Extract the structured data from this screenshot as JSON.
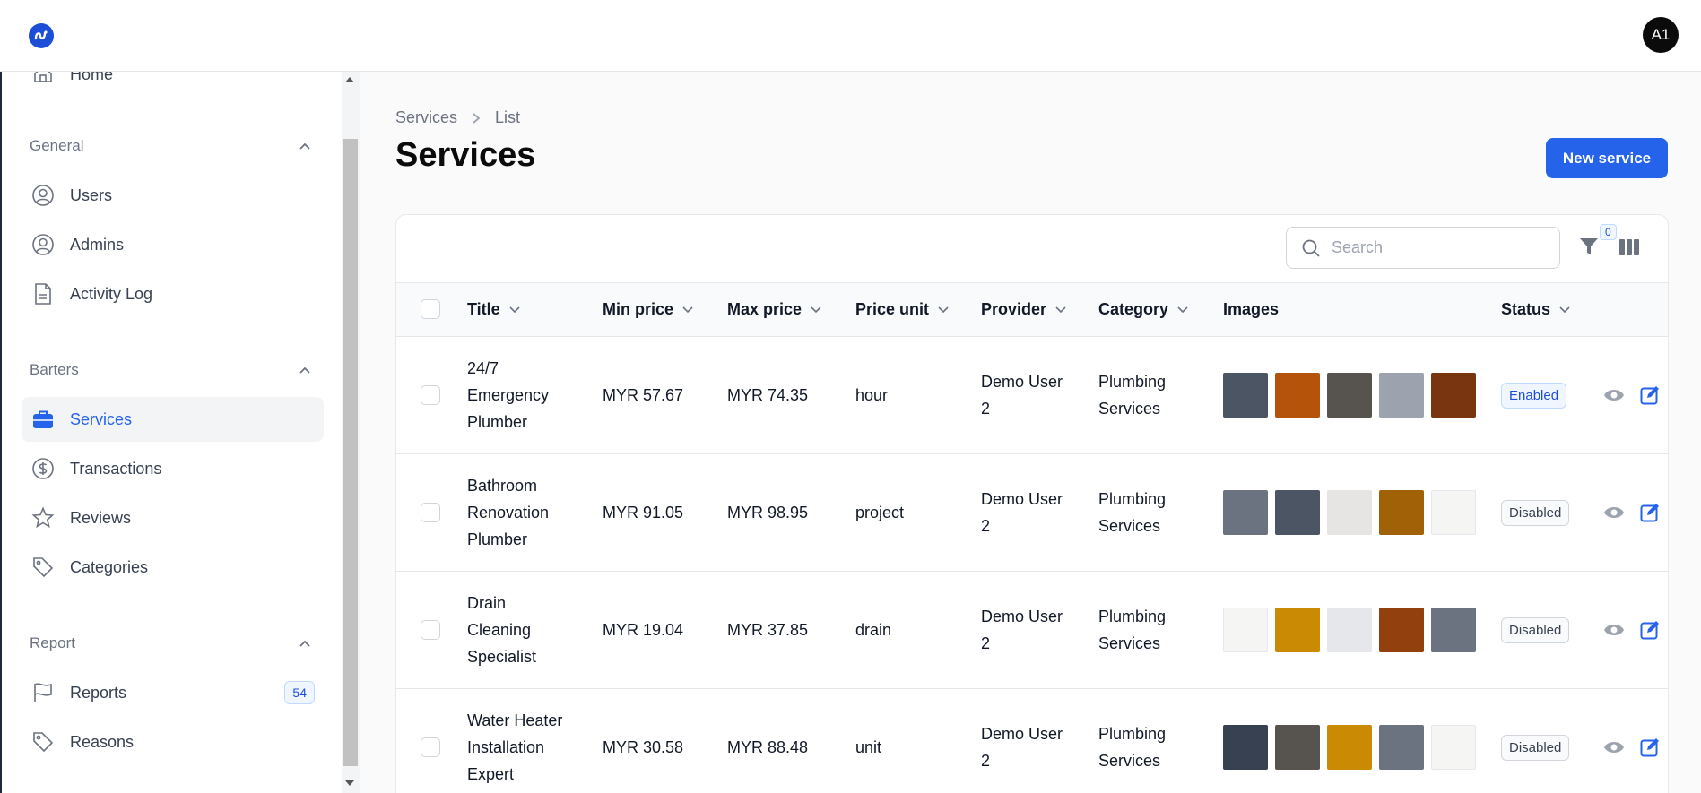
{
  "header": {
    "avatar_initials": "A1"
  },
  "sidebar": {
    "home_label": "Home",
    "groups": [
      {
        "label": "General",
        "items": [
          {
            "label": "Users",
            "icon": "user-circle-icon"
          },
          {
            "label": "Admins",
            "icon": "user-circle-icon"
          },
          {
            "label": "Activity Log",
            "icon": "document-icon"
          }
        ]
      },
      {
        "label": "Barters",
        "items": [
          {
            "label": "Services",
            "icon": "briefcase-icon",
            "active": true
          },
          {
            "label": "Transactions",
            "icon": "dollar-circle-icon"
          },
          {
            "label": "Reviews",
            "icon": "star-icon"
          },
          {
            "label": "Categories",
            "icon": "tag-icon"
          }
        ]
      },
      {
        "label": "Report",
        "items": [
          {
            "label": "Reports",
            "icon": "flag-icon",
            "badge": "54"
          },
          {
            "label": "Reasons",
            "icon": "tag-icon"
          }
        ]
      }
    ]
  },
  "breadcrumb": {
    "items": [
      "Services",
      "List"
    ]
  },
  "page": {
    "title": "Services",
    "new_button": "New service"
  },
  "table": {
    "search_placeholder": "Search",
    "filter_count": "0",
    "columns": [
      "Title",
      "Min price",
      "Max price",
      "Price unit",
      "Provider",
      "Category",
      "Images",
      "Status"
    ],
    "rows": [
      {
        "title": [
          "24/7",
          "Emergency",
          "Plumber"
        ],
        "min_price": "MYR 57.67",
        "max_price": "MYR 74.35",
        "price_unit": "hour",
        "provider": [
          "Demo User",
          "2"
        ],
        "category": [
          "Plumbing",
          "Services"
        ],
        "status": "Enabled",
        "images": [
          "#4b5563",
          "#b45309",
          "#57534e",
          "#9ca3af",
          "#78350f"
        ]
      },
      {
        "title": [
          "Bathroom",
          "Renovation",
          "Plumber"
        ],
        "min_price": "MYR 91.05",
        "max_price": "MYR 98.95",
        "price_unit": "project",
        "provider": [
          "Demo User",
          "2"
        ],
        "category": [
          "Plumbing",
          "Services"
        ],
        "status": "Disabled",
        "images": [
          "#6b7280",
          "#4b5563",
          "#e7e5e4",
          "#a16207",
          "#f5f5f4"
        ]
      },
      {
        "title": [
          "Drain",
          "Cleaning",
          "Specialist"
        ],
        "min_price": "MYR 19.04",
        "max_price": "MYR 37.85",
        "price_unit": "drain",
        "provider": [
          "Demo User",
          "2"
        ],
        "category": [
          "Plumbing",
          "Services"
        ],
        "status": "Disabled",
        "images": [
          "#f5f5f4",
          "#ca8a04",
          "#e5e7eb",
          "#92400e",
          "#6b7280"
        ]
      },
      {
        "title": [
          "Water Heater",
          "Installation",
          "Expert"
        ],
        "min_price": "MYR 30.58",
        "max_price": "MYR 88.48",
        "price_unit": "unit",
        "provider": [
          "Demo User",
          "2"
        ],
        "category": [
          "Plumbing",
          "Services"
        ],
        "status": "Disabled",
        "images": [
          "#374151",
          "#57534e",
          "#ca8a04",
          "#6b7280",
          "#f5f5f4"
        ]
      }
    ]
  },
  "colors": {
    "accent": "#2563eb",
    "enabled": "#1d4ed8"
  }
}
